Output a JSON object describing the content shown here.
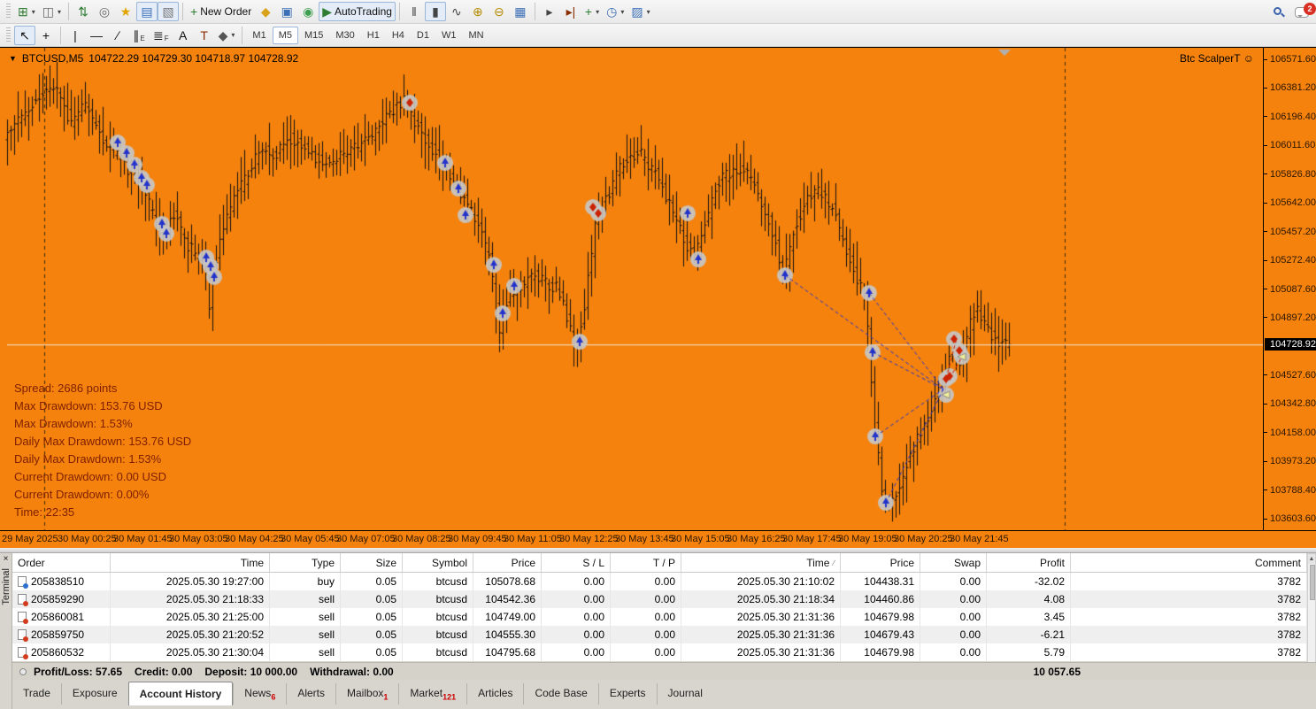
{
  "toolbar_main": {
    "buttons": [
      {
        "name": "new-chart-button",
        "glyph": "⊞",
        "color": "#2e7d32",
        "dropdown": true
      },
      {
        "name": "profiles-button",
        "glyph": "◫",
        "color": "#666",
        "dropdown": true
      },
      {
        "sep": true
      },
      {
        "name": "symbols-button",
        "glyph": "⇅",
        "color": "#2e7d32"
      },
      {
        "name": "cursor-target-button",
        "glyph": "◎",
        "color": "#666"
      },
      {
        "name": "favorites-button",
        "glyph": "★",
        "color": "#e2a400"
      },
      {
        "name": "market-watch-button",
        "glyph": "▤",
        "color": "#3b6fb6",
        "pressed": true
      },
      {
        "name": "data-window-button",
        "glyph": "▧",
        "color": "#777",
        "pressed": true
      },
      {
        "sep": true
      },
      {
        "name": "new-order-button",
        "glyph": "+",
        "color": "#2e7d32",
        "label": "New Order"
      },
      {
        "name": "metaeditor-button",
        "glyph": "◆",
        "color": "#d9a21b"
      },
      {
        "name": "strategy-tester-button",
        "glyph": "▣",
        "color": "#3b6fb6"
      },
      {
        "name": "signals-button",
        "glyph": "◉",
        "color": "#3d9e4e"
      },
      {
        "name": "autotrading-button",
        "glyph": "▶",
        "color": "#2e7d32",
        "label": "AutoTrading",
        "pressed": true
      },
      {
        "sep": true
      },
      {
        "name": "bar-chart-button",
        "glyph": "‖",
        "color": "#444"
      },
      {
        "name": "candlestick-chart-button",
        "glyph": "▮",
        "color": "#444",
        "pressed": true
      },
      {
        "name": "line-chart-button",
        "glyph": "∿",
        "color": "#444"
      },
      {
        "name": "zoom-in-button",
        "glyph": "⊕",
        "color": "#b58b00"
      },
      {
        "name": "zoom-out-button",
        "glyph": "⊖",
        "color": "#b58b00"
      },
      {
        "name": "tile-windows-button",
        "glyph": "▦",
        "color": "#3b6fb6"
      },
      {
        "sep": true
      },
      {
        "name": "auto-scroll-button",
        "glyph": "▸",
        "color": "#444"
      },
      {
        "name": "chart-shift-button",
        "glyph": "▸|",
        "color": "#8a2c00"
      },
      {
        "name": "indicators-button",
        "glyph": "+",
        "color": "#2e7d32",
        "dropdown": true
      },
      {
        "name": "periods-button",
        "glyph": "◷",
        "color": "#3b6fb6",
        "dropdown": true
      },
      {
        "name": "templates-button",
        "glyph": "▨",
        "color": "#3b6fb6",
        "dropdown": true
      }
    ],
    "notification_count": "2"
  },
  "toolbar_draw": {
    "buttons": [
      {
        "name": "cursor-tool",
        "glyph": "↖",
        "color": "#111",
        "pressed": true
      },
      {
        "name": "crosshair-tool",
        "glyph": "+",
        "color": "#111"
      },
      {
        "sep": true
      },
      {
        "name": "vertical-line-tool",
        "glyph": "|",
        "color": "#111"
      },
      {
        "name": "horizontal-line-tool",
        "glyph": "—",
        "color": "#111"
      },
      {
        "name": "trendline-tool",
        "glyph": "∕",
        "color": "#111"
      },
      {
        "name": "equidistant-channel-tool",
        "glyph": "∥",
        "sub": "E",
        "color": "#111"
      },
      {
        "name": "fibonacci-tool",
        "glyph": "≣",
        "sub": "F",
        "color": "#111"
      },
      {
        "name": "text-tool",
        "glyph": "A",
        "color": "#111"
      },
      {
        "name": "text-label-tool",
        "glyph": "T",
        "color": "#8a2c00"
      },
      {
        "name": "arrows-tool",
        "glyph": "◆",
        "color": "#555",
        "dropdown": true
      },
      {
        "sep": true
      }
    ]
  },
  "timeframes": {
    "items": [
      "M1",
      "M5",
      "M15",
      "M30",
      "H1",
      "H4",
      "D1",
      "W1",
      "MN"
    ],
    "active": "M5"
  },
  "chart": {
    "title_symbol": "BTCUSD,M5",
    "title_ohlc": "104722.29 104729.30 104718.97 104728.92",
    "dropdown_glyph": "▼",
    "expert_label": "Btc ScalperT ☺",
    "annotations": [
      "Spread: 2686 points",
      "Max Drawdown: 153.76 USD",
      "Max Drawdown: 1.53%",
      "Daily Max Drawdown: 153.76 USD",
      "Daily Max Drawdown: 1.53%",
      "Current Drawdown: 0.00 USD",
      "Current Drawdown: 0.00%",
      "Time: 22:35"
    ],
    "current_price": "104728.92"
  },
  "chart_data": {
    "type": "candlestick",
    "symbol": "BTCUSD",
    "timeframe": "M5",
    "title": "BTCUSD,M5",
    "last_ohlc": {
      "open": 104722.29,
      "high": 104729.3,
      "low": 104718.97,
      "close": 104728.92
    },
    "current_price": 104728.92,
    "y_ticks": [
      "106571.60",
      "106381.20",
      "106196.40",
      "106011.60",
      "105826.80",
      "105642.00",
      "105457.20",
      "105272.40",
      "105087.60",
      "104897.20",
      "",
      "104527.60",
      "104342.80",
      "104158.00",
      "103973.20",
      "103788.40",
      "103603.60"
    ],
    "y_axis_top": 106571.6,
    "y_axis_bottom": 103603.6,
    "x_ticks": [
      "29 May 2025",
      "30 May 00:25",
      "30 May 01:45",
      "30 May 03:05",
      "30 May 04:25",
      "30 May 05:45",
      "30 May 07:05",
      "30 May 08:25",
      "30 May 09:45",
      "30 May 11:05",
      "30 May 12:25",
      "30 May 13:45",
      "30 May 15:05",
      "30 May 16:25",
      "30 May 17:45",
      "30 May 19:05",
      "30 May 20:25",
      "30 May 21:45"
    ],
    "bars_count": 284,
    "price_path": [
      [
        8,
        106091
      ],
      [
        40,
        106280
      ],
      [
        65,
        106406
      ],
      [
        85,
        106150
      ],
      [
        100,
        106291
      ],
      [
        120,
        106060
      ],
      [
        140,
        105920
      ],
      [
        160,
        105777
      ],
      [
        175,
        105600
      ],
      [
        185,
        105462
      ],
      [
        200,
        105560
      ],
      [
        215,
        105380
      ],
      [
        228,
        105290
      ],
      [
        239,
        105176
      ],
      [
        241,
        104800
      ],
      [
        243,
        105100
      ],
      [
        255,
        105500
      ],
      [
        270,
        105691
      ],
      [
        285,
        105850
      ],
      [
        300,
        106005
      ],
      [
        315,
        105950
      ],
      [
        330,
        106062
      ],
      [
        345,
        106000
      ],
      [
        360,
        105930
      ],
      [
        375,
        105891
      ],
      [
        390,
        105960
      ],
      [
        405,
        106005
      ],
      [
        420,
        106050
      ],
      [
        435,
        106150
      ],
      [
        450,
        106250
      ],
      [
        460,
        106308
      ],
      [
        470,
        106200
      ],
      [
        480,
        106091
      ],
      [
        492,
        105990
      ],
      [
        505,
        105891
      ],
      [
        518,
        105736
      ],
      [
        530,
        105640
      ],
      [
        540,
        105548
      ],
      [
        550,
        105400
      ],
      [
        558,
        105244
      ],
      [
        565,
        104930
      ],
      [
        568,
        104800
      ],
      [
        572,
        104950
      ],
      [
        578,
        105050
      ],
      [
        585,
        105062
      ],
      [
        595,
        105120
      ],
      [
        610,
        105176
      ],
      [
        620,
        105130
      ],
      [
        635,
        105090
      ],
      [
        645,
        104900
      ],
      [
        652,
        104780
      ],
      [
        657,
        104747
      ],
      [
        663,
        104950
      ],
      [
        670,
        105250
      ],
      [
        678,
        105560
      ],
      [
        685,
        105634
      ],
      [
        695,
        105750
      ],
      [
        705,
        105891
      ],
      [
        715,
        105940
      ],
      [
        725,
        105977
      ],
      [
        735,
        105900
      ],
      [
        745,
        105834
      ],
      [
        755,
        105700
      ],
      [
        763,
        105577
      ],
      [
        773,
        105450
      ],
      [
        781,
        105350
      ],
      [
        788,
        105279
      ],
      [
        795,
        105400
      ],
      [
        802,
        105519
      ],
      [
        810,
        105700
      ],
      [
        818,
        105805
      ],
      [
        830,
        105840
      ],
      [
        845,
        105862
      ],
      [
        858,
        105720
      ],
      [
        870,
        105577
      ],
      [
        880,
        105380
      ],
      [
        888,
        105176
      ],
      [
        897,
        105400
      ],
      [
        905,
        105548
      ],
      [
        915,
        105650
      ],
      [
        925,
        105748
      ],
      [
        935,
        105680
      ],
      [
        945,
        105605
      ],
      [
        953,
        105450
      ],
      [
        962,
        105290
      ],
      [
        972,
        105160
      ],
      [
        980,
        105062
      ],
      [
        984,
        104870
      ],
      [
        988,
        104500
      ],
      [
        993,
        104147
      ],
      [
        997,
        103950
      ],
      [
        1001,
        103706
      ],
      [
        1006,
        103680
      ],
      [
        1012,
        103746
      ],
      [
        1018,
        103800
      ],
      [
        1025,
        103918
      ],
      [
        1032,
        104000
      ],
      [
        1040,
        104118
      ],
      [
        1046,
        104190
      ],
      [
        1052,
        104261
      ],
      [
        1058,
        104350
      ],
      [
        1065,
        104433
      ],
      [
        1071,
        104560
      ],
      [
        1078,
        104719
      ],
      [
        1083,
        104640
      ],
      [
        1088,
        104576
      ],
      [
        1093,
        104700
      ],
      [
        1098,
        104833
      ],
      [
        1103,
        104900
      ],
      [
        1108,
        104947
      ],
      [
        1113,
        104890
      ],
      [
        1118,
        104844
      ],
      [
        1123,
        104800
      ],
      [
        1128,
        104747
      ],
      [
        1132,
        104735
      ],
      [
        1140,
        104729
      ]
    ],
    "markers": {
      "buy": [
        [
          133,
          106034
        ],
        [
          143,
          105965
        ],
        [
          152,
          105891
        ],
        [
          160,
          105805
        ],
        [
          166,
          105759
        ],
        [
          183,
          105508
        ],
        [
          188,
          105445
        ],
        [
          233,
          105290
        ],
        [
          238,
          105233
        ],
        [
          242,
          105165
        ],
        [
          503,
          105902
        ],
        [
          518,
          105736
        ],
        [
          526,
          105565
        ],
        [
          558,
          105244
        ],
        [
          568,
          104930
        ],
        [
          581,
          105107
        ],
        [
          655,
          104747
        ],
        [
          777,
          105577
        ],
        [
          789,
          105279
        ],
        [
          887,
          105176
        ],
        [
          982,
          105062
        ],
        [
          986,
          104679
        ],
        [
          989,
          104135
        ],
        [
          1001,
          103706
        ]
      ],
      "sell": [
        [
          463,
          106291
        ],
        [
          670,
          105617
        ],
        [
          676,
          105577
        ],
        [
          1069,
          104507
        ],
        [
          1073,
          104524
        ],
        [
          1078,
          104764
        ],
        [
          1084,
          104690
        ]
      ],
      "close": [
        [
          1087,
          104650
        ],
        [
          1069,
          104404
        ]
      ]
    },
    "trade_lines": {
      "blue": [
        [
          982,
          105062,
          1066,
          104440
        ],
        [
          986,
          104679,
          1066,
          104440
        ],
        [
          989,
          104135,
          1066,
          104440
        ],
        [
          1001,
          103706,
          1066,
          104440
        ],
        [
          887,
          105176,
          1066,
          104440
        ]
      ],
      "red": [
        [
          1069,
          104507,
          1081,
          104770
        ],
        [
          1073,
          104510,
          1087,
          104650
        ]
      ]
    },
    "separators_x": [
      50,
      1203
    ],
    "shift_marker_x": 1135,
    "colors": {
      "background": "#F5820D",
      "bars": "#111111",
      "buy": "#2233cc",
      "sell": "#cc2200",
      "close_fill": "#f2ef9a",
      "marker_halo": "#c8c8c8",
      "price_line": "#efe8d8"
    }
  },
  "terminal": {
    "close_label": "×",
    "side_label": "Terminal",
    "columns": [
      "Order",
      "Time",
      "Type",
      "Size",
      "Symbol",
      "Price",
      "S / L",
      "T / P",
      "Time",
      "Price",
      "Swap",
      "Profit",
      "Comment"
    ],
    "sort_column_index": 8,
    "sort_glyph": "∕",
    "rows": [
      {
        "order": "205838510",
        "time": "2025.05.30 19:27:00",
        "type": "buy",
        "size": "0.05",
        "symbol": "btcusd",
        "price": "105078.68",
        "sl": "0.00",
        "tp": "0.00",
        "time2": "2025.05.30 21:10:02",
        "price2": "104438.31",
        "swap": "0.00",
        "profit": "-32.02",
        "comment": "3782"
      },
      {
        "order": "205859290",
        "time": "2025.05.30 21:18:33",
        "type": "sell",
        "size": "0.05",
        "symbol": "btcusd",
        "price": "104542.36",
        "sl": "0.00",
        "tp": "0.00",
        "time2": "2025.05.30 21:18:34",
        "price2": "104460.86",
        "swap": "0.00",
        "profit": "4.08",
        "comment": "3782"
      },
      {
        "order": "205860081",
        "time": "2025.05.30 21:25:00",
        "type": "sell",
        "size": "0.05",
        "symbol": "btcusd",
        "price": "104749.00",
        "sl": "0.00",
        "tp": "0.00",
        "time2": "2025.05.30 21:31:36",
        "price2": "104679.98",
        "swap": "0.00",
        "profit": "3.45",
        "comment": "3782"
      },
      {
        "order": "205859750",
        "time": "2025.05.30 21:20:52",
        "type": "sell",
        "size": "0.05",
        "symbol": "btcusd",
        "price": "104555.30",
        "sl": "0.00",
        "tp": "0.00",
        "time2": "2025.05.30 21:31:36",
        "price2": "104679.43",
        "swap": "0.00",
        "profit": "-6.21",
        "comment": "3782"
      },
      {
        "order": "205860532",
        "time": "2025.05.30 21:30:04",
        "type": "sell",
        "size": "0.05",
        "symbol": "btcusd",
        "price": "104795.68",
        "sl": "0.00",
        "tp": "0.00",
        "time2": "2025.05.30 21:31:36",
        "price2": "104679.98",
        "swap": "0.00",
        "profit": "5.79",
        "comment": "3782"
      }
    ],
    "summary": {
      "segments": [
        "Profit/Loss: 57.65",
        "Credit: 0.00",
        "Deposit: 10 000.00",
        "Withdrawal: 0.00"
      ],
      "balance": "10 057.65"
    },
    "tabs": [
      {
        "label": "Trade"
      },
      {
        "label": "Exposure"
      },
      {
        "label": "Account History",
        "active": true
      },
      {
        "label": "News",
        "badge": "6"
      },
      {
        "label": "Alerts"
      },
      {
        "label": "Mailbox",
        "badge": "1"
      },
      {
        "label": "Market",
        "badge": "121"
      },
      {
        "label": "Articles"
      },
      {
        "label": "Code Base"
      },
      {
        "label": "Experts"
      },
      {
        "label": "Journal"
      }
    ]
  }
}
